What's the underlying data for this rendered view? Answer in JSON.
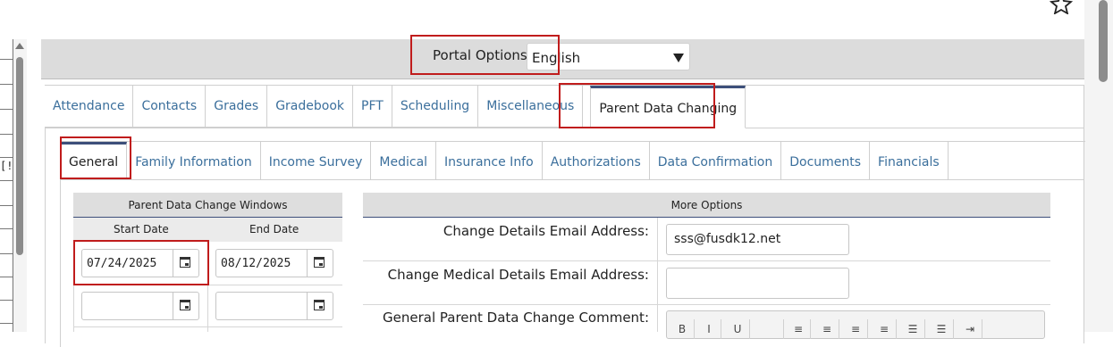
{
  "portal": {
    "label": "Portal Options:",
    "language_value": "English"
  },
  "main_tabs": [
    {
      "label": "Attendance",
      "active": false
    },
    {
      "label": "Contacts",
      "active": false
    },
    {
      "label": "Grades",
      "active": false
    },
    {
      "label": "Gradebook",
      "active": false
    },
    {
      "label": "PFT",
      "active": false
    },
    {
      "label": "Scheduling",
      "active": false
    },
    {
      "label": "Miscellaneous",
      "active": false
    },
    {
      "label": "Parent Data Changing",
      "active": true
    }
  ],
  "sub_tabs": [
    {
      "label": "General",
      "active": true
    },
    {
      "label": "Family Information",
      "active": false
    },
    {
      "label": "Income Survey",
      "active": false
    },
    {
      "label": "Medical",
      "active": false
    },
    {
      "label": "Insurance Info",
      "active": false
    },
    {
      "label": "Authorizations",
      "active": false
    },
    {
      "label": "Data Confirmation",
      "active": false
    },
    {
      "label": "Documents",
      "active": false
    },
    {
      "label": "Financials",
      "active": false
    }
  ],
  "change_windows": {
    "title": "Parent Data Change Windows",
    "start_header": "Start Date",
    "end_header": "End Date",
    "rows": [
      {
        "start": "07/24/2025",
        "end": "08/12/2025"
      },
      {
        "start": "",
        "end": ""
      }
    ]
  },
  "more_options": {
    "title": "More Options",
    "change_email_label": "Change Details Email Address:",
    "change_email_value": "sss@fusdk12.net",
    "medical_email_label": "Change Medical Details Email Address:",
    "medical_email_value": "",
    "comment_label": "General Parent Data Change Comment:"
  },
  "left_strip": {
    "flag": "[!]"
  },
  "colors": {
    "accent": "#3d4f7a",
    "link": "#3b6f9c",
    "highlight": "#c01c1c"
  }
}
